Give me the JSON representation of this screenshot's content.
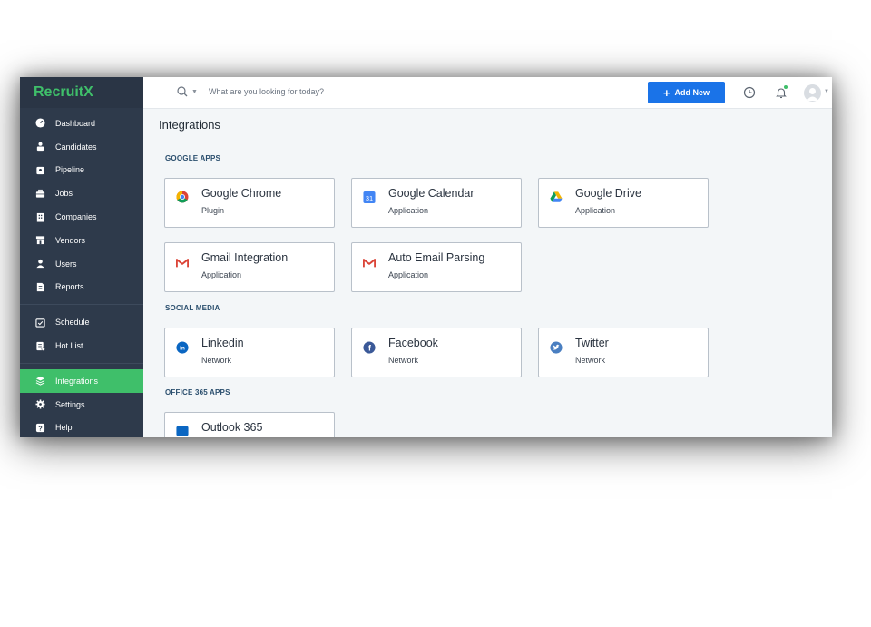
{
  "app": {
    "name": "RecruitX"
  },
  "colors": {
    "sidebar": "#2e3a4b",
    "accent": "#3fbf6a",
    "primary_button": "#1a73e8"
  },
  "sidebar": {
    "items": [
      {
        "label": "Dashboard",
        "icon": "dashboard-icon"
      },
      {
        "label": "Candidates",
        "icon": "candidates-icon"
      },
      {
        "label": "Pipeline",
        "icon": "pipeline-icon"
      },
      {
        "label": "Jobs",
        "icon": "briefcase-icon"
      },
      {
        "label": "Companies",
        "icon": "building-icon"
      },
      {
        "label": "Vendors",
        "icon": "store-icon"
      },
      {
        "label": "Users",
        "icon": "user-icon"
      },
      {
        "label": "Reports",
        "icon": "report-icon"
      }
    ],
    "items2": [
      {
        "label": "Schedule",
        "icon": "calendar-check-icon"
      },
      {
        "label": "Hot List",
        "icon": "hot-list-icon"
      }
    ],
    "items3": [
      {
        "label": "Integrations",
        "icon": "layers-icon",
        "active": true
      },
      {
        "label": "Settings",
        "icon": "gear-icon"
      },
      {
        "label": "Help",
        "icon": "help-icon"
      }
    ]
  },
  "topbar": {
    "search_placeholder": "What are you looking for today?",
    "add_new_label": "Add New"
  },
  "page": {
    "title": "Integrations"
  },
  "sections": {
    "google": {
      "label": "GOOGLE APPS",
      "cards": [
        {
          "title": "Google Chrome",
          "subtitle": "Plugin",
          "icon": "chrome-icon"
        },
        {
          "title": "Google Calendar",
          "subtitle": "Application",
          "icon": "google-calendar-icon",
          "icon_text": "31"
        },
        {
          "title": "Google Drive",
          "subtitle": "Application",
          "icon": "google-drive-icon"
        },
        {
          "title": "Gmail Integration",
          "subtitle": "Application",
          "icon": "gmail-icon"
        },
        {
          "title": "Auto Email Parsing",
          "subtitle": "Application",
          "icon": "gmail-icon"
        }
      ]
    },
    "social": {
      "label": "SOCIAL MEDIA",
      "cards": [
        {
          "title": "Linkedin",
          "subtitle": "Network",
          "icon": "linkedin-icon",
          "icon_text": "in"
        },
        {
          "title": "Facebook",
          "subtitle": "Network",
          "icon": "facebook-icon",
          "icon_text": "f"
        },
        {
          "title": "Twitter",
          "subtitle": "Network",
          "icon": "twitter-icon"
        }
      ]
    },
    "office": {
      "label": "OFFICE 365 APPS",
      "cards": [
        {
          "title": "Outlook 365",
          "icon": "outlook-icon"
        }
      ]
    }
  }
}
